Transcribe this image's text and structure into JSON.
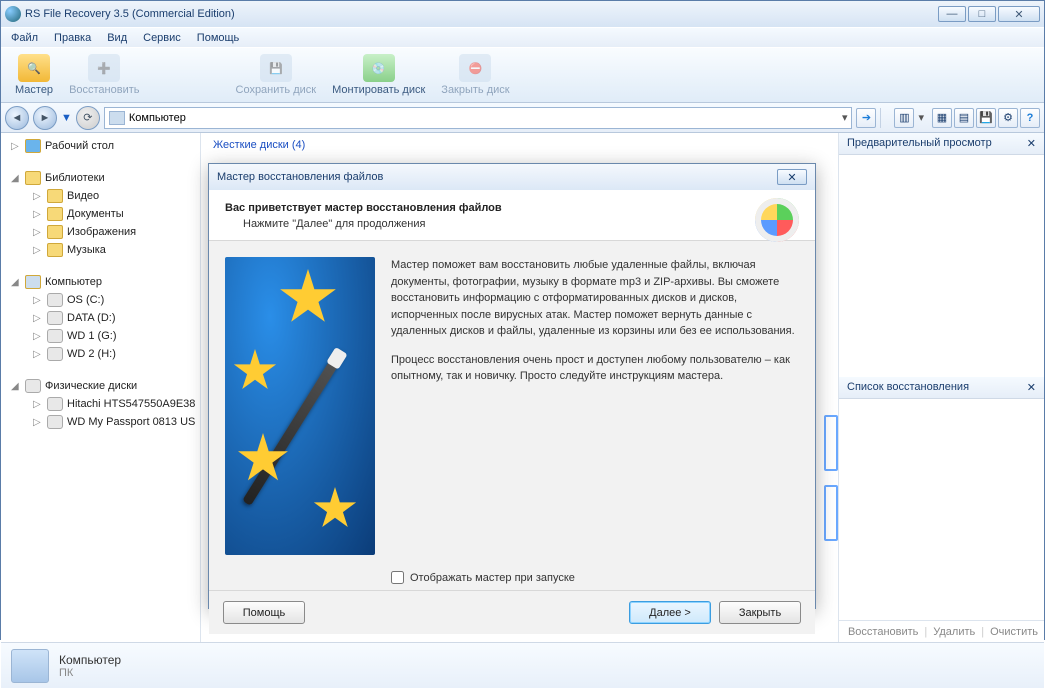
{
  "window": {
    "title": "RS File Recovery 3.5 (Commercial Edition)"
  },
  "menu": {
    "file": "Файл",
    "edit": "Правка",
    "view": "Вид",
    "service": "Сервис",
    "help": "Помощь"
  },
  "toolbar": {
    "wizard": "Мастер",
    "recover": "Восстановить",
    "save_disk": "Сохранить диск",
    "mount_disk": "Монтировать диск",
    "close_disk": "Закрыть диск"
  },
  "address": {
    "location": "Компьютер"
  },
  "tree": {
    "desktop": "Рабочий стол",
    "libraries": "Библиотеки",
    "lib_items": [
      "Видео",
      "Документы",
      "Изображения",
      "Музыка"
    ],
    "computer": "Компьютер",
    "drives": [
      "OS (C:)",
      "DATA (D:)",
      "WD 1 (G:)",
      "WD 2 (H:)"
    ],
    "physical": "Физические диски",
    "phys_items": [
      "Hitachi HTS547550A9E38",
      "WD My Passport 0813 US"
    ]
  },
  "center": {
    "header": "Жесткие диски (4)"
  },
  "right": {
    "preview_title": "Предварительный просмотр",
    "list_title": "Список восстановления",
    "actions": {
      "recover": "Восстановить",
      "delete": "Удалить",
      "clear": "Очистить"
    }
  },
  "status": {
    "name": "Компьютер",
    "type": "ПК"
  },
  "dialog": {
    "title": "Мастер восстановления файлов",
    "heading": "Вас приветствует мастер восстановления файлов",
    "subheading": "Нажмите \"Далее\" для продолжения",
    "para1": "Мастер поможет вам восстановить любые удаленные файлы, включая документы, фотографии, музыку в формате mp3 и ZIP-архивы. Вы сможете восстановить информацию с отформатированных дисков и дисков, испорченных после вирусных атак. Мастер поможет вернуть данные с удаленных дисков и файлы, удаленные из корзины или без ее использования.",
    "para2": "Процесс восстановления очень прост и доступен любому пользователю – как опытному, так и новичку. Просто следуйте инструкциям мастера.",
    "checkbox": "Отображать мастер при запуске",
    "help": "Помощь",
    "next": "Далее >",
    "close": "Закрыть"
  }
}
